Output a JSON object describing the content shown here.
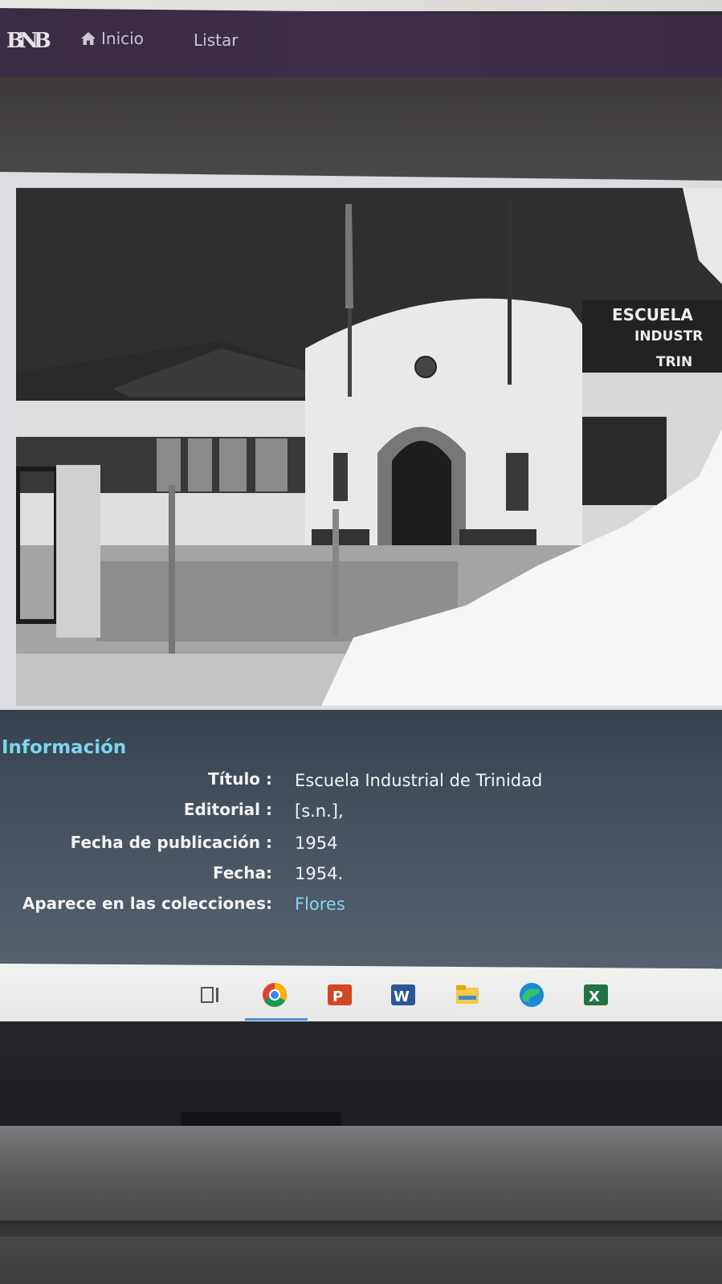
{
  "navbar": {
    "logo_text": "BNB",
    "home_label": "Inicio",
    "list_label": "Listar",
    "home_icon": "home-icon"
  },
  "photo": {
    "sign_line1": "ESCUELA",
    "sign_line2": "INDUSTR",
    "sign_line3": "TRIN"
  },
  "info": {
    "heading": "Información",
    "rows": [
      {
        "label": "Título :",
        "value": "Escuela Industrial de Trinidad"
      },
      {
        "label": "Editorial :",
        "value": "[s.n.],"
      },
      {
        "label": "Fecha de publicación :",
        "value": "1954"
      },
      {
        "label": "Fecha:",
        "value": "1954."
      },
      {
        "label": "Aparece en las colecciones:",
        "value": "Flores"
      }
    ]
  },
  "taskbar": {
    "icons": [
      "task-view-icon",
      "chrome-icon",
      "powerpoint-icon",
      "word-icon",
      "file-explorer-icon",
      "edge-icon",
      "excel-icon"
    ],
    "colors": {
      "chrome": "#db4437",
      "powerpoint": "#d24726",
      "word": "#2b579a",
      "explorer": "#f2c94c",
      "edge": "#1a8ad4",
      "excel": "#217346"
    }
  }
}
